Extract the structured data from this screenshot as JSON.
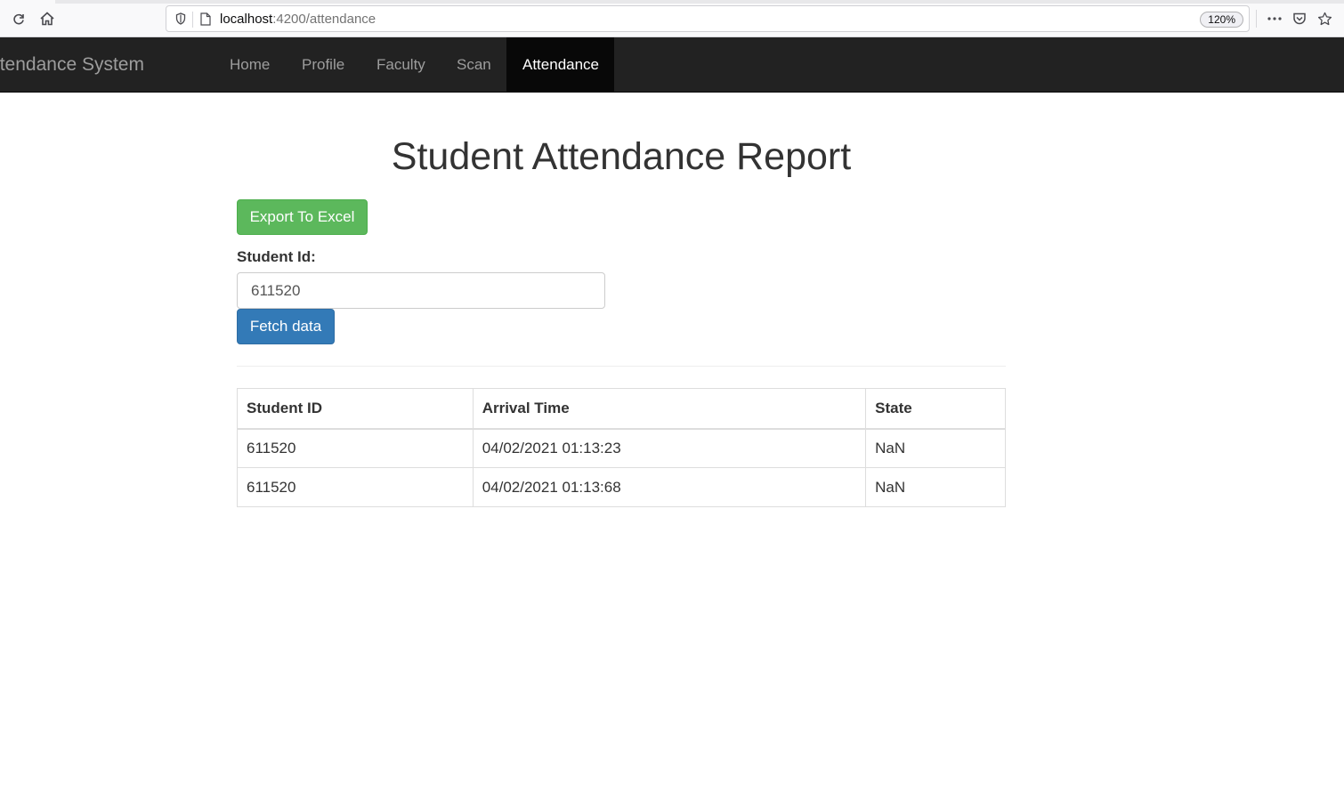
{
  "browser": {
    "url_host": "localhost",
    "url_path": ":4200/attendance",
    "zoom": "120%"
  },
  "navbar": {
    "brand": "ent Attendance System",
    "items": [
      {
        "label": "Home"
      },
      {
        "label": "Profile"
      },
      {
        "label": "Faculty"
      },
      {
        "label": "Scan"
      },
      {
        "label": "Attendance"
      }
    ]
  },
  "main": {
    "title": "Student Attendance Report",
    "export_button": "Export To Excel",
    "student_id_label": "Student Id:",
    "student_id_value": "611520",
    "fetch_button": "Fetch data"
  },
  "table": {
    "headers": [
      "Student ID",
      "Arrival Time",
      "State"
    ],
    "rows": [
      [
        "611520",
        "04/02/2021 01:13:23",
        "NaN"
      ],
      [
        "611520",
        "04/02/2021 01:13:68",
        "NaN"
      ]
    ]
  },
  "colors": {
    "navbar_bg": "#222222",
    "nav_active_bg": "#080808",
    "success": "#5cb85c",
    "primary": "#337ab7"
  }
}
